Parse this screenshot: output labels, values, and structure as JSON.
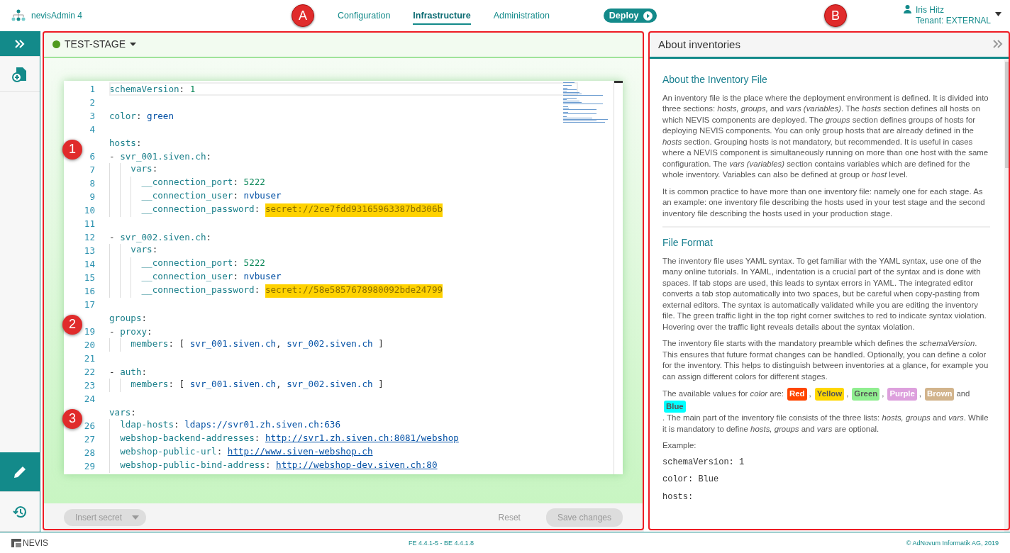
{
  "header": {
    "app_name": "nevisAdmin 4",
    "nav": [
      {
        "label": "Configuration",
        "selected": false
      },
      {
        "label": "Infrastructure",
        "selected": true
      },
      {
        "label": "Administration",
        "selected": false
      }
    ],
    "deploy": "Deploy",
    "user": {
      "name": "Iris Hitz",
      "tenant": "Tenant: EXTERNAL"
    }
  },
  "sidebar": {
    "top": [
      {
        "kind": "expand",
        "selected": true
      },
      {
        "kind": "add-file",
        "selected": false
      }
    ],
    "bottom": [
      {
        "kind": "edit",
        "selected": true
      },
      {
        "kind": "history",
        "selected": false
      }
    ]
  },
  "editor_panel": {
    "annotation": "A",
    "stage": {
      "name": "TEST-STAGE",
      "color": "#4f9a1e"
    },
    "lines": [
      {
        "n": "1",
        "kind": "root",
        "active": true,
        "t": [
          {
            "kind": "key",
            "text": "schemaVersion"
          },
          {
            "kind": "punct",
            "text": ": "
          },
          {
            "kind": "number",
            "text": "1"
          }
        ]
      },
      {
        "n": "2",
        "kind": "root",
        "active": false
      },
      {
        "n": "3",
        "kind": "root",
        "active": false,
        "t": [
          {
            "kind": "key",
            "text": "color"
          },
          {
            "kind": "punct",
            "text": ": "
          },
          {
            "kind": "string",
            "text": "green"
          }
        ]
      },
      {
        "n": "4",
        "kind": "root",
        "active": false
      },
      {
        "badge": "1",
        "kind": "root",
        "active": false,
        "t": [
          {
            "kind": "key",
            "text": "hosts"
          },
          {
            "kind": "punct",
            "text": ":"
          }
        ]
      },
      {
        "n": "6",
        "kind": "root",
        "active": false,
        "t": [
          {
            "kind": "punct",
            "text": "- "
          },
          {
            "kind": "key",
            "text": "svr_001.siven.ch"
          },
          {
            "kind": "punct",
            "text": ":"
          }
        ]
      },
      {
        "n": "7",
        "kind": "nested",
        "active": false,
        "t": [
          {
            "kind": "key",
            "text": "vars"
          },
          {
            "kind": "punct",
            "text": ":"
          }
        ]
      },
      {
        "n": "8",
        "kind": "deep",
        "active": false,
        "t": [
          {
            "kind": "key",
            "text": "__connection_port"
          },
          {
            "kind": "punct",
            "text": ": "
          },
          {
            "kind": "number",
            "text": "5222"
          }
        ]
      },
      {
        "n": "9",
        "kind": "deep",
        "active": false,
        "t": [
          {
            "kind": "key",
            "text": "__connection_user"
          },
          {
            "kind": "punct",
            "text": ": "
          },
          {
            "kind": "string",
            "text": "nvbuser"
          }
        ]
      },
      {
        "n": "10",
        "kind": "deep",
        "active": false,
        "t": [
          {
            "kind": "key",
            "text": "__connection_password"
          },
          {
            "kind": "punct",
            "text": ": "
          },
          {
            "kind": "secret",
            "text": "secret://2ce7fdd93165963387bd306b"
          }
        ]
      },
      {
        "n": "11",
        "kind": "root",
        "active": false
      },
      {
        "n": "12",
        "kind": "root",
        "active": false,
        "t": [
          {
            "kind": "punct",
            "text": "- "
          },
          {
            "kind": "key",
            "text": "svr_002.siven.ch"
          },
          {
            "kind": "punct",
            "text": ":"
          }
        ]
      },
      {
        "n": "13",
        "kind": "nested",
        "active": false,
        "t": [
          {
            "kind": "key",
            "text": "vars"
          },
          {
            "kind": "punct",
            "text": ":"
          }
        ]
      },
      {
        "n": "14",
        "kind": "deep",
        "active": false,
        "t": [
          {
            "kind": "key",
            "text": "__connection_port"
          },
          {
            "kind": "punct",
            "text": ": "
          },
          {
            "kind": "number",
            "text": "5222"
          }
        ]
      },
      {
        "n": "15",
        "kind": "deep",
        "active": false,
        "t": [
          {
            "kind": "key",
            "text": "__connection_user"
          },
          {
            "kind": "punct",
            "text": ": "
          },
          {
            "kind": "string",
            "text": "nvbuser"
          }
        ]
      },
      {
        "n": "16",
        "kind": "deep",
        "active": false,
        "t": [
          {
            "kind": "key",
            "text": "__connection_password"
          },
          {
            "kind": "punct",
            "text": ": "
          },
          {
            "kind": "secret",
            "text": "secret://58e5857678980092bde24799"
          }
        ]
      },
      {
        "n": "17",
        "kind": "root",
        "active": false
      },
      {
        "badge": "2",
        "kind": "root",
        "active": false,
        "t": [
          {
            "kind": "key",
            "text": "groups"
          },
          {
            "kind": "punct",
            "text": ":"
          }
        ]
      },
      {
        "n": "19",
        "kind": "root",
        "active": false,
        "t": [
          {
            "kind": "punct",
            "text": "- "
          },
          {
            "kind": "key",
            "text": "proxy"
          },
          {
            "kind": "punct",
            "text": ":"
          }
        ]
      },
      {
        "n": "20",
        "kind": "nested",
        "active": false,
        "t": [
          {
            "kind": "key",
            "text": "members"
          },
          {
            "kind": "punct",
            "text": ": [ "
          },
          {
            "kind": "string",
            "text": "svr_001.siven.ch"
          },
          {
            "kind": "punct",
            "text": ", "
          },
          {
            "kind": "string",
            "text": "svr_002.siven.ch"
          },
          {
            "kind": "punct",
            "text": " ]"
          }
        ]
      },
      {
        "n": "21",
        "kind": "root",
        "active": false
      },
      {
        "n": "22",
        "kind": "root",
        "active": false,
        "t": [
          {
            "kind": "punct",
            "text": "- "
          },
          {
            "kind": "key",
            "text": "auth"
          },
          {
            "kind": "punct",
            "text": ":"
          }
        ]
      },
      {
        "n": "23",
        "kind": "nested",
        "active": false,
        "t": [
          {
            "kind": "key",
            "text": "members"
          },
          {
            "kind": "punct",
            "text": ": [ "
          },
          {
            "kind": "string",
            "text": "svr_001.siven.ch"
          },
          {
            "kind": "punct",
            "text": ", "
          },
          {
            "kind": "string",
            "text": "svr_002.siven.ch"
          },
          {
            "kind": "punct",
            "text": " ]"
          }
        ]
      },
      {
        "n": "24",
        "kind": "root",
        "active": false
      },
      {
        "badge": "3",
        "kind": "root",
        "active": false,
        "t": [
          {
            "kind": "key",
            "text": "vars"
          },
          {
            "kind": "punct",
            "text": ":"
          }
        ]
      },
      {
        "n": "26",
        "kind": "shallow",
        "active": false,
        "t": [
          {
            "kind": "key",
            "text": "ldap-hosts"
          },
          {
            "kind": "punct",
            "text": ": "
          },
          {
            "kind": "string",
            "text": "ldaps://svr01.zh.siven.ch:636"
          }
        ]
      },
      {
        "n": "27",
        "kind": "shallow",
        "active": false,
        "t": [
          {
            "kind": "key",
            "text": "webshop-backend-addresses"
          },
          {
            "kind": "punct",
            "text": ": "
          },
          {
            "kind": "link",
            "text": "http://svr1.zh.siven.ch:8081/webshop"
          }
        ]
      },
      {
        "n": "28",
        "kind": "shallow",
        "active": false,
        "t": [
          {
            "kind": "key",
            "text": "webshop-public-url"
          },
          {
            "kind": "punct",
            "text": ": "
          },
          {
            "kind": "link",
            "text": "http://www.siven-webshop.ch"
          }
        ]
      },
      {
        "n": "29",
        "kind": "shallow",
        "active": false,
        "t": [
          {
            "kind": "key",
            "text": "webshop-public-bind-address"
          },
          {
            "kind": "punct",
            "text": ": "
          },
          {
            "kind": "link",
            "text": "http://webshop-dev.siven.ch:80"
          }
        ]
      }
    ],
    "footer": {
      "insert_secret": {
        "label": "Insert secret",
        "disabled": true
      },
      "reset": "Reset",
      "save": {
        "label": "Save changes",
        "disabled": true
      }
    }
  },
  "help_panel": {
    "annotation": "B",
    "title": "About inventories",
    "sections": [
      {
        "heading": "About the Inventory File",
        "paragraphs": [
          "An inventory file is the place where the deployment environment is defined. It is divided into three sections: *hosts, groups,* and *vars (variables)*. The *hosts* section defines all hosts on which NEVIS components are deployed. The *groups* section defines groups of hosts for deploying NEVIS components. You can only group hosts that are already defined in the *hosts* section. Grouping hosts is not mandatory, but recommended. It is useful in cases where a NEVIS component is simultaneously running on more than one host with the same configuration. The *vars (variables)* section contains variables which are defined for the whole inventory. Variables can also be defined at group or *host* level.",
          "It is common practice to have more than one inventory file: namely one for each stage. As an example: one inventory file describing the hosts used in your test stage and the second inventory file describing the hosts used in your production stage."
        ]
      },
      {
        "heading": "File Format",
        "paragraphs": [
          "The inventory file uses YAML syntax. To get familiar with the YAML syntax, use one of the many online tutorials. In YAML, indentation is a crucial part of the syntax and is done with spaces. If tab stops are used, this leads to syntax errors in YAML. The integrated editor converts a tab stop automatically into two spaces, but be careful when copy-pasting from external editors. The syntax is automatically validated while you are editing the inventory file. The green traffic light in the top right corner switches to red to indicate syntax violation. Hovering over the traffic light reveals details about the syntax violation.",
          "The inventory file starts with the mandatory preamble which defines the *schemaVersion*. This ensures that future format changes can be handled. Optionally, you can define a color for the inventory. This helps to distinguish between inventories at a glance, for example you can assign different colors for different stages."
        ],
        "color_values": {
          "intro": "The available values for *color* are:",
          "items": [
            {
              "label": "Red",
              "color": "#ff4500",
              "sep": ","
            },
            {
              "label": "Yellow",
              "color": "#ffd700",
              "sep": ","
            },
            {
              "label": "Green",
              "color": "#90ee90",
              "sep": ","
            },
            {
              "label": "Purple",
              "color": "#dda0dd",
              "sep": ","
            },
            {
              "label": "Brown",
              "color": "#d2b48c",
              "sep": "and"
            },
            {
              "label": "Blue",
              "color": "#00ffff"
            }
          ],
          "after": ". The main part of the inventory file consists of the three lists: *hosts, groups* and *vars*. While it is mandatory to define *hosts, groups* and *vars* are optional."
        },
        "example_label": "Example:",
        "example_lines": [
          "schemaVersion: 1",
          "color: Blue",
          "hosts:"
        ]
      }
    ]
  },
  "status_bar": {
    "brand": "NEVIS",
    "version": "FE 4.4.1-5 - BE 4.4.1.8",
    "copyright": "© AdNovum Informatik AG, 2019"
  }
}
